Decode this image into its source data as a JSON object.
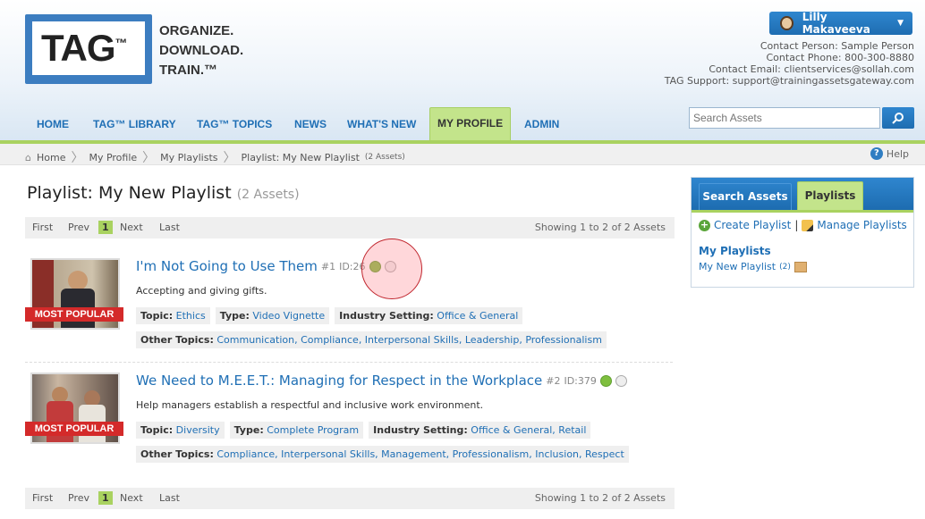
{
  "header": {
    "logo_text": "TAG",
    "logo_tm": "™",
    "tagline": [
      "ORGANIZE.",
      "DOWNLOAD.",
      "TRAIN.™"
    ],
    "user_name": "Lilly Makaveeva",
    "contact": [
      "Contact Person: Sample Person",
      "Contact Phone: 800-300-8880",
      "Contact Email: clientservices@sollah.com",
      "TAG Support: support@trainingassetsgateway.com"
    ]
  },
  "nav": {
    "items": [
      {
        "label": "HOME"
      },
      {
        "label": "TAG™ LIBRARY"
      },
      {
        "label": "TAG™ TOPICS"
      },
      {
        "label": "NEWS"
      },
      {
        "label": "WHAT'S NEW"
      },
      {
        "label": "MY PROFILE"
      },
      {
        "label": "ADMIN"
      }
    ],
    "active": "MY PROFILE"
  },
  "search": {
    "placeholder": "Search Assets"
  },
  "breadcrumb": {
    "home": "Home",
    "my_profile": "My Profile",
    "my_playlists": "My Playlists",
    "current": "Playlist: My New Playlist",
    "current_count": "(2 Assets)",
    "help": "Help"
  },
  "page": {
    "title": "Playlist: My New Playlist",
    "count": "(2 Assets)"
  },
  "pager": {
    "first": "First",
    "prev": "Prev",
    "current": "1",
    "next": "Next",
    "last": "Last",
    "showing": "Showing 1 to 2 of 2 Assets"
  },
  "assets": [
    {
      "title": "I'm Not Going to Use Them",
      "number": "#1",
      "id": "ID:26",
      "badge": "MOST POPULAR",
      "description": "Accepting and giving gifts.",
      "topic_label": "Topic:",
      "topic": "Ethics",
      "type_label": "Type:",
      "type": "Video Vignette",
      "industry_label": "Industry Setting:",
      "industry": "Office & General",
      "other_label": "Other Topics:",
      "other": "Communication, Compliance, Interpersonal Skills, Leadership, Professionalism"
    },
    {
      "title": "We Need to M.E.E.T.: Managing for Respect in the Workplace",
      "number": "#2",
      "id": "ID:379",
      "badge": "MOST POPULAR",
      "description": "Help managers establish a respectful and inclusive work environment.",
      "topic_label": "Topic:",
      "topic": "Diversity",
      "type_label": "Type:",
      "type": "Complete Program",
      "industry_label": "Industry Setting:",
      "industry": "Office & General, Retail",
      "other_label": "Other Topics:",
      "other": "Compliance, Interpersonal Skills, Management, Professionalism, Inclusion, Respect"
    }
  ],
  "sidebar": {
    "tab_search": "Search Assets",
    "tab_playlists": "Playlists",
    "create": "Create Playlist",
    "divider": "|",
    "manage": "Manage Playlists",
    "heading": "My Playlists",
    "item": "My New Playlist",
    "item_count": "(2)"
  },
  "colors": {
    "brand_blue": "#1f6fb5",
    "accent_green": "#a9d260",
    "badge_red": "#d42a2a"
  }
}
